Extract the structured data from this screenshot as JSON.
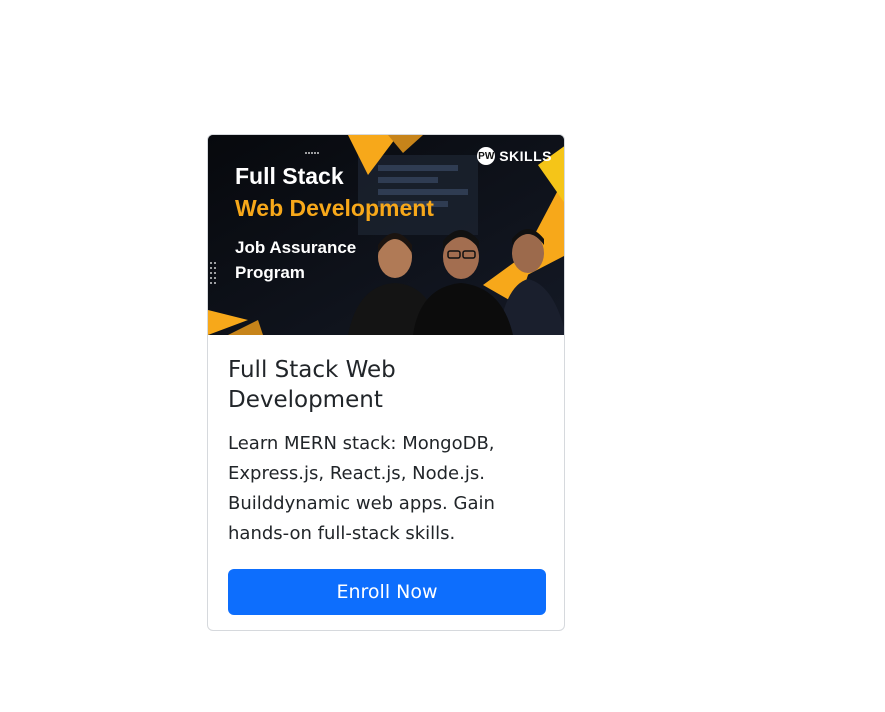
{
  "course_card": {
    "banner": {
      "line1": "Full Stack",
      "line2": "Web Development",
      "line3": "Job Assurance",
      "line4": "Program",
      "brand_logo": "PW",
      "brand_name": "SKILLS"
    },
    "title": "Full Stack Web Development",
    "description": "Learn MERN stack: MongoDB, Express.js, React.js, Node.js. Builddynamic web apps. Gain hands-on full-stack skills.",
    "button_label": "Enroll Now"
  },
  "colors": {
    "accent": "#0d6efd",
    "banner_orange": "#f7a81a",
    "banner_dark": "#0b0d12"
  }
}
